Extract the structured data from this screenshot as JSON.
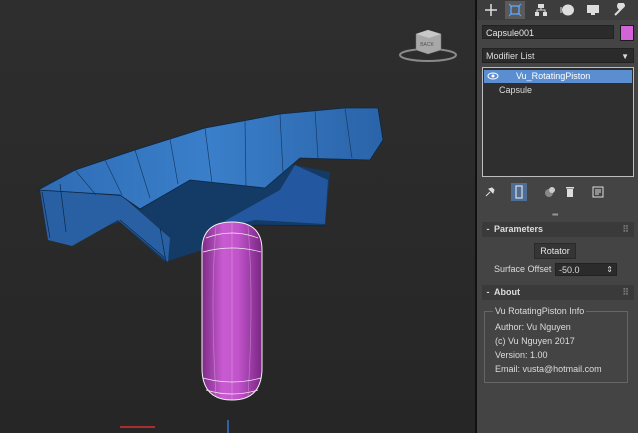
{
  "viewport": {
    "viewcube_label": "BACK"
  },
  "panel": {
    "tabs": [
      {
        "name": "create-tab",
        "icon": "plus-icon"
      },
      {
        "name": "modify-tab",
        "icon": "modify-icon"
      },
      {
        "name": "hierarchy-tab",
        "icon": "hierarchy-icon"
      },
      {
        "name": "motion-tab",
        "icon": "motion-icon"
      },
      {
        "name": "display-tab",
        "icon": "display-icon"
      },
      {
        "name": "utilities-tab",
        "icon": "wrench-icon"
      }
    ],
    "object_name": "Capsule001",
    "object_color": "#d264d8",
    "modifier_list_label": "Modifier List",
    "stack_items": [
      "Vu_RotatingPiston",
      "Capsule"
    ],
    "parameters": {
      "title": "Parameters",
      "sign": "-",
      "rotator_button": "Rotator",
      "surface_offset_label": "Surface Offset",
      "surface_offset_value": "-50.0"
    },
    "about": {
      "title": "About",
      "sign": "-",
      "group_title": "Vu RotatingPiston Info",
      "author": "Author: Vu Nguyen",
      "copyright": "(c) Vu Nguyen 2017",
      "version": "Version: 1.00",
      "email": "Email: vusta@hotmail.com"
    }
  },
  "colors": {
    "accent": "#5b8ed0",
    "capsule": "#c056cc",
    "piston": "#2e6fb8"
  }
}
